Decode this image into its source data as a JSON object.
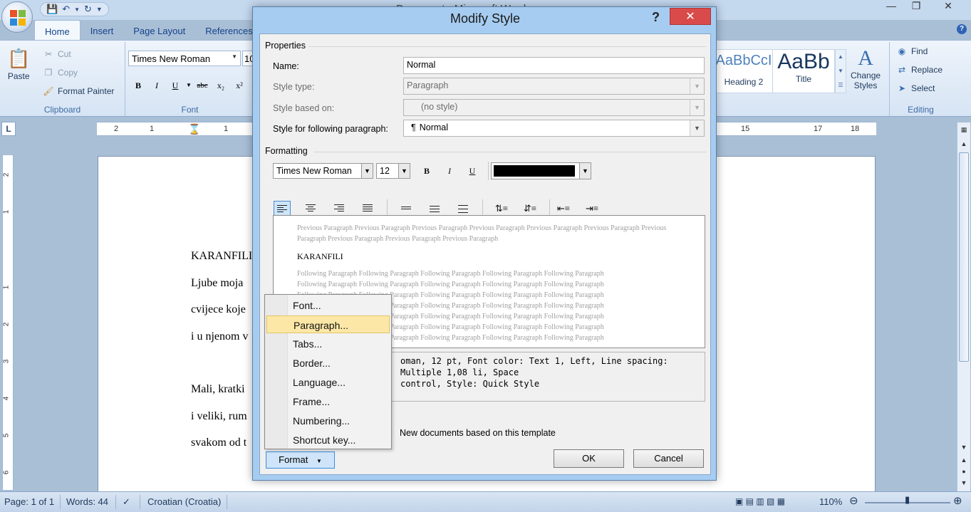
{
  "word": {
    "title": "Document - Microsoft Word",
    "tabs": [
      "Home",
      "Insert",
      "Page Layout",
      "References"
    ],
    "clipboard": {
      "paste": "Paste",
      "cut": "Cut",
      "copy": "Copy",
      "format_painter": "Format Painter",
      "group_label": "Clipboard"
    },
    "font": {
      "family": "Times New Roman",
      "size": "10",
      "group_label": "Font"
    },
    "styles": [
      {
        "sample": "AaBbCcI",
        "name": "Heading 2"
      },
      {
        "sample": "AaBb",
        "name": "Title"
      }
    ],
    "change_styles": [
      "Change",
      "Styles"
    ],
    "editing": {
      "find": "Find",
      "replace": "Replace",
      "select": "Select",
      "group_label": "Editing"
    },
    "ruler_h": [
      "2",
      "1",
      "1",
      "15",
      "17",
      "18"
    ],
    "ruler_v": [
      "2",
      "1",
      "1",
      "2",
      "3",
      "4",
      "5",
      "6"
    ],
    "document_lines": [
      "KARANFILI",
      "Ljube moja",
      "cvijece koje",
      "i u njenom v",
      "Mali, kratki",
      "i veliki, rum",
      "svakom od t"
    ],
    "status": {
      "page": "Page: 1 of 1",
      "words": "Words: 44",
      "language": "Croatian (Croatia)",
      "zoom": "110%"
    }
  },
  "dialog": {
    "title": "Modify Style",
    "help": "?",
    "close": "✕",
    "properties_heading": "Properties",
    "name_label": "Name:",
    "name_value": "Normal",
    "style_type_label": "Style type:",
    "style_type_value": "Paragraph",
    "based_on_label": "Style based on:",
    "based_on_value": "(no style)",
    "following_label": "Style for following paragraph:",
    "following_value": "Normal",
    "formatting_heading": "Formatting",
    "font_family": "Times New Roman",
    "font_size": "12",
    "font_color": "#000000",
    "preview_previous": "Previous Paragraph Previous Paragraph Previous Paragraph Previous Paragraph Previous Paragraph Previous Paragraph Previous Paragraph Previous Paragraph Previous Paragraph Previous Paragraph",
    "preview_current": "KARANFILI",
    "preview_following": "Following Paragraph Following Paragraph Following Paragraph Following Paragraph Following Paragraph",
    "description_line1": "oman, 12 pt, Font color: Text 1, Left, Line spacing:  Multiple 1,08 li, Space",
    "description_line2": "control, Style: Quick Style",
    "new_docs_label": "New documents based on this template",
    "ok": "OK",
    "cancel": "Cancel",
    "format_button": "Format",
    "format_menu": [
      "Font...",
      "Paragraph...",
      "Tabs...",
      "Border...",
      "Language...",
      "Frame...",
      "Numbering...",
      "Shortcut key..."
    ],
    "highlighted_menu_item": "Paragraph..."
  }
}
